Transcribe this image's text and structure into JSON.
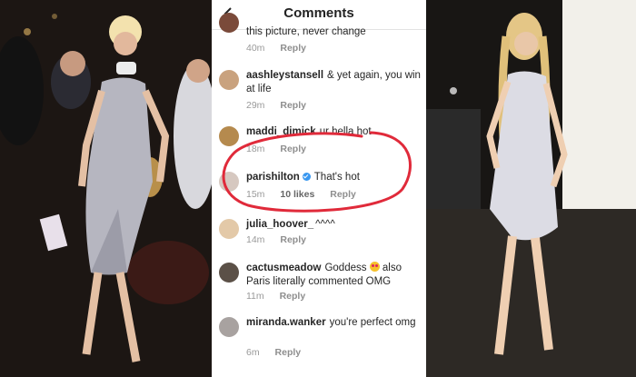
{
  "header": {
    "title": "Comments"
  },
  "comments": [
    {
      "username": "",
      "text": "this picture, never change",
      "time": "40m",
      "likes": "",
      "reply": "Reply"
    },
    {
      "username": "aashleystansell",
      "text": "& yet again, you win at life",
      "time": "29m",
      "likes": "",
      "reply": "Reply"
    },
    {
      "username": "maddi_dimick",
      "text": "ur hella hot",
      "time": "18m",
      "likes": "",
      "reply": "Reply"
    },
    {
      "username": "parishilton",
      "text": "That's hot",
      "time": "15m",
      "likes": "10 likes",
      "reply": "Reply",
      "verified": true
    },
    {
      "username": "julia_hoover_",
      "text": "^^^^",
      "time": "14m",
      "likes": "",
      "reply": "Reply"
    },
    {
      "username": "cactusmeadow",
      "text_before": "Goddess",
      "text_after": "also Paris literally commented OMG",
      "emoji": "heart-eyes-emoji",
      "time": "11m",
      "likes": "",
      "reply": "Reply"
    },
    {
      "username": "miranda.wanker",
      "text": "you're perfect omg",
      "time": "6m",
      "likes": "",
      "reply": "Reply"
    }
  ],
  "colors": {
    "annotation_circle": "#e02a3a",
    "verified_badge": "#3897f0",
    "muted_text": "#999999"
  }
}
